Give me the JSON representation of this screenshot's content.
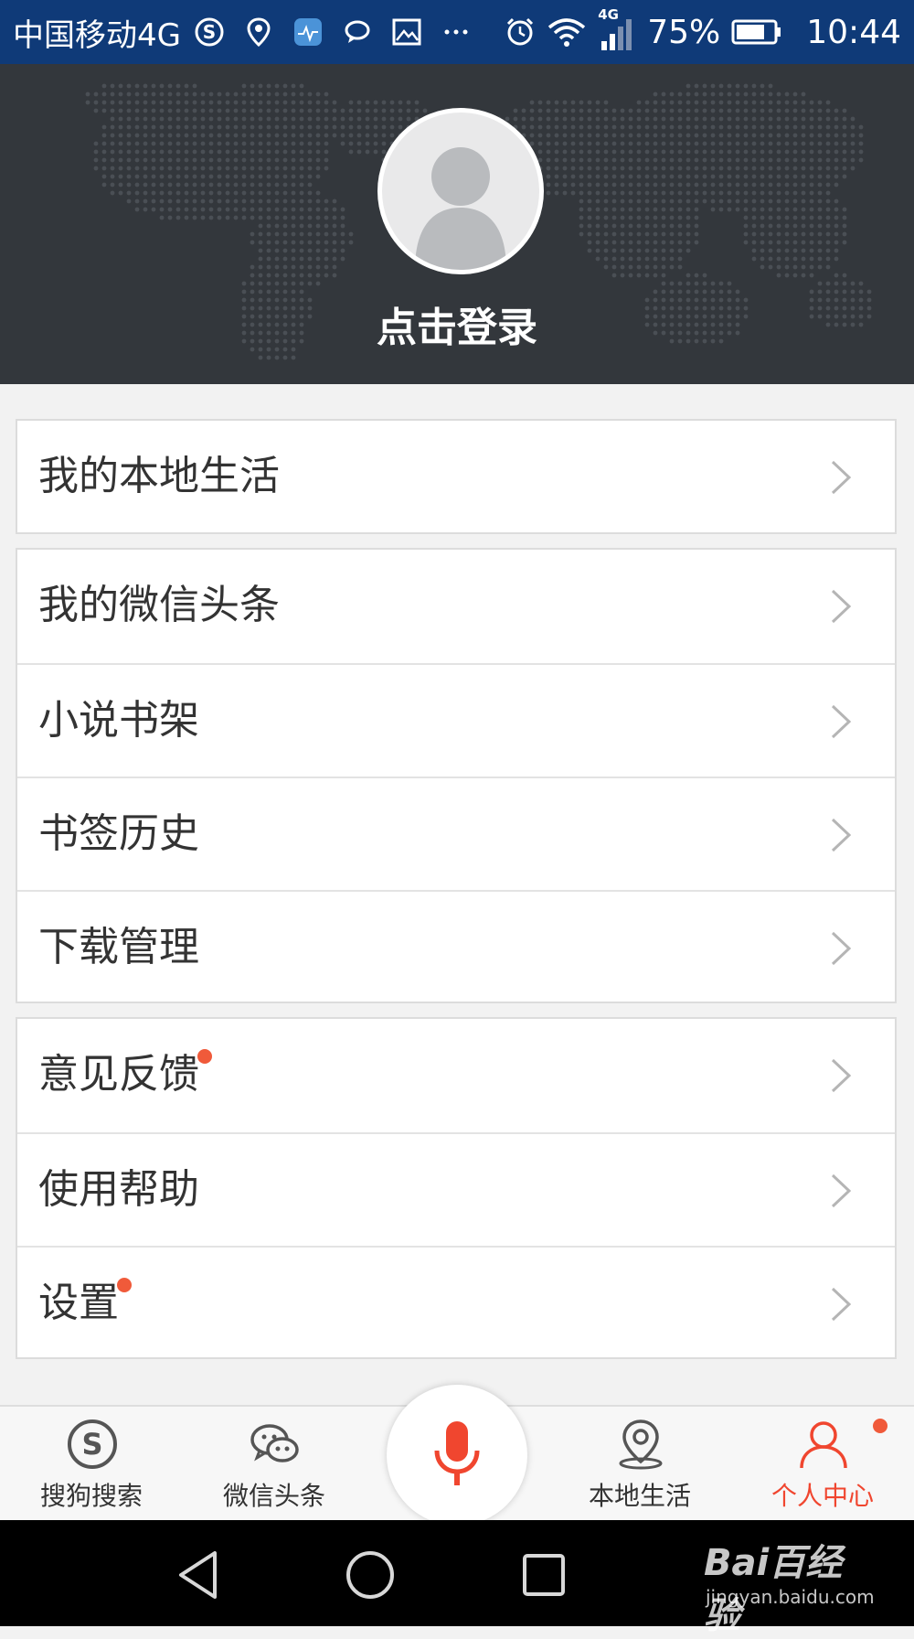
{
  "status_bar": {
    "carrier": "中国移动4G",
    "network_badge": "4G",
    "battery_percent": "75%",
    "time": "10:44",
    "icons_left": [
      "sogou-s-icon",
      "location-pin-icon",
      "health-app-icon",
      "chat-bubble-icon",
      "image-icon",
      "more-dots-icon"
    ],
    "icons_right": [
      "alarm-icon",
      "wifi-icon",
      "signal-icon",
      "battery-icon"
    ]
  },
  "header": {
    "login_label": "点击登录",
    "avatar_icon": "default-avatar-icon",
    "background": "world-map-dots"
  },
  "menu_groups": [
    {
      "items": [
        {
          "label": "我的本地生活",
          "badge": false
        }
      ]
    },
    {
      "items": [
        {
          "label": "我的微信头条",
          "badge": false
        },
        {
          "label": "小说书架",
          "badge": false
        },
        {
          "label": "书签历史",
          "badge": false
        },
        {
          "label": "下载管理",
          "badge": false
        }
      ]
    },
    {
      "items": [
        {
          "label": "意见反馈",
          "badge": true
        },
        {
          "label": "使用帮助",
          "badge": false
        },
        {
          "label": "设置",
          "badge": true
        }
      ]
    }
  ],
  "tab_bar": {
    "tabs": [
      {
        "label": "搜狗搜索",
        "icon": "sogou-search-icon",
        "active": false
      },
      {
        "label": "微信头条",
        "icon": "wechat-icon",
        "active": false
      },
      {
        "label": "本地生活",
        "icon": "location-icon",
        "active": false
      },
      {
        "label": "个人中心",
        "icon": "person-icon",
        "active": true,
        "badge": true
      }
    ],
    "voice_button": "microphone-icon"
  },
  "nav_bar": {
    "buttons": [
      "back-triangle-icon",
      "home-circle-icon",
      "recents-square-icon"
    ]
  },
  "watermark": {
    "main": "Bai百经验",
    "sub": "jingyan.baidu.com"
  },
  "colors": {
    "status_bar": "#0f3a78",
    "header_bg": "#33373c",
    "accent": "#f0462f",
    "badge": "#f05a3a",
    "page_bg": "#f2f2f2"
  }
}
